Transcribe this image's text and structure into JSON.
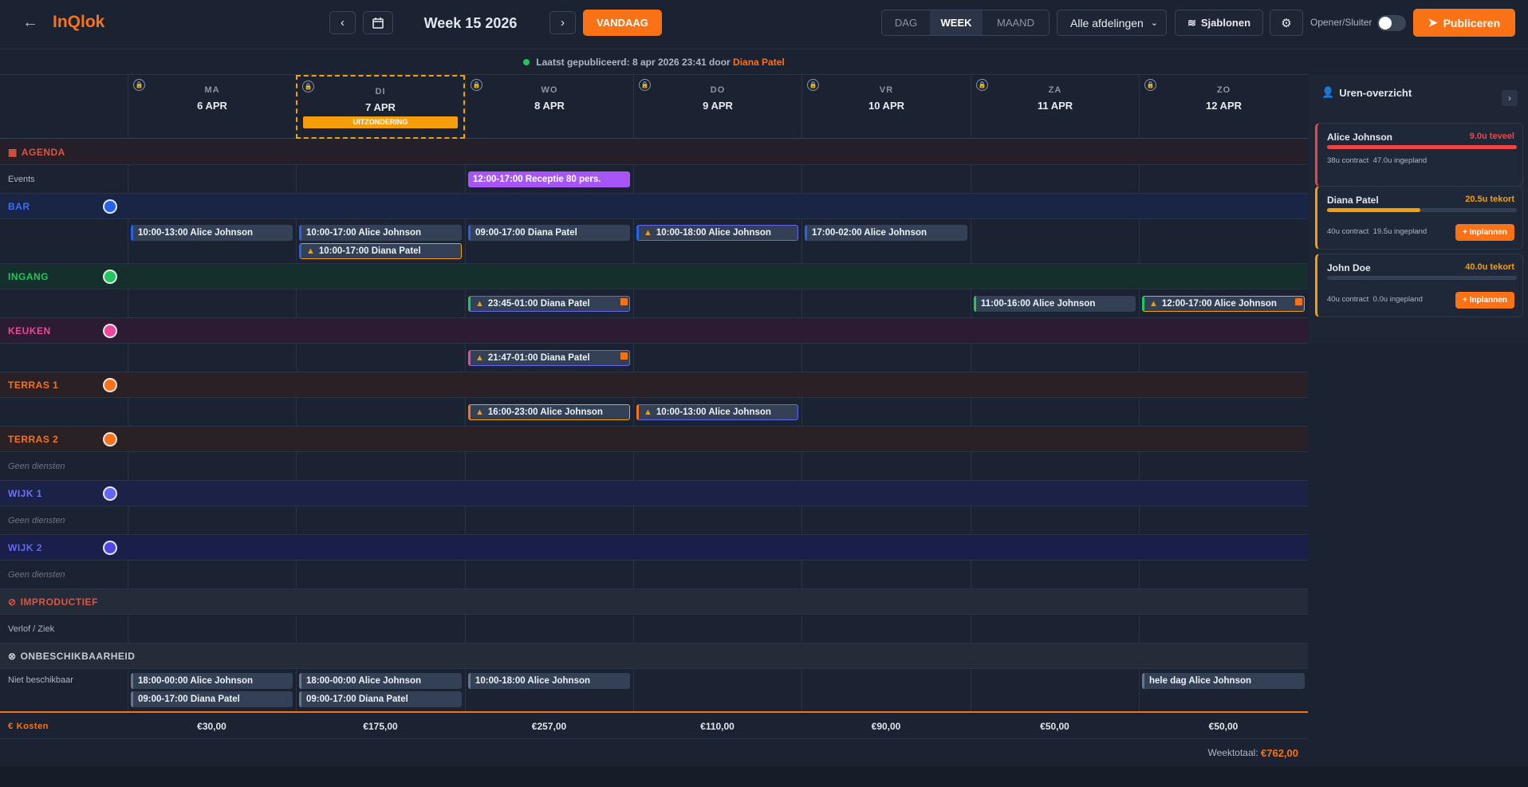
{
  "header": {
    "logo": "InQlok",
    "week_title": "Week 15 2026",
    "today": "VANDAAG",
    "views": [
      "DAG",
      "WEEK",
      "MAAND"
    ],
    "dept_select": "Alle afdelingen",
    "templates": "Sjablonen",
    "opener_label": "Opener/Sluiter",
    "publish": "Publiceren"
  },
  "status": {
    "text": "Laatst gepubliceerd: 8 apr 2026 23:41 door",
    "user": "Diana Patel"
  },
  "days": [
    {
      "name": "MA",
      "date": "6 APR"
    },
    {
      "name": "DI",
      "date": "7 APR",
      "badge": "UITZONDERING"
    },
    {
      "name": "WO",
      "date": "8 APR"
    },
    {
      "name": "DO",
      "date": "9 APR"
    },
    {
      "name": "VR",
      "date": "10 APR"
    },
    {
      "name": "ZA",
      "date": "11 APR"
    },
    {
      "name": "ZO",
      "date": "12 APR"
    }
  ],
  "agenda": {
    "title": "AGENDA",
    "events_label": "Events",
    "event": "12:00-17:00 Receptie 80 pers."
  },
  "departments": [
    {
      "name": "BAR",
      "color": "#2563eb"
    },
    {
      "name": "INGANG",
      "color": "#22c55e"
    },
    {
      "name": "KEUKEN",
      "color": "#ec4899"
    },
    {
      "name": "TERRAS 1",
      "color": "#f97316"
    },
    {
      "name": "TERRAS 2",
      "color": "#f97316"
    },
    {
      "name": "WIJK 1",
      "color": "#6366f1"
    },
    {
      "name": "WIJK 2",
      "color": "#4f46e5"
    }
  ],
  "empty_label": "Geen diensten",
  "shifts": {
    "bar": [
      "10:00-13:00 Alice Johnson",
      "10:00-17:00 Alice Johnson",
      "10:00-17:00 Diana Patel",
      "09:00-17:00 Diana Patel",
      "10:00-18:00 Alice Johnson",
      "17:00-02:00 Alice Johnson"
    ],
    "ingang": [
      "23:45-01:00 Diana Patel",
      "11:00-16:00 Alice Johnson",
      "12:00-17:00 Alice Johnson"
    ],
    "keuken": [
      "21:47-01:00 Diana Patel"
    ],
    "terras1": [
      "16:00-23:00 Alice Johnson",
      "10:00-13:00 Alice Johnson"
    ]
  },
  "improductief": {
    "title": "IMPRODUCTIEF",
    "label": "Verlof / Ziek"
  },
  "onbeschikbaar": {
    "title": "ONBESCHIKBAARHEID",
    "label": "Niet beschikbaar",
    "items": [
      "18:00-00:00 Alice Johnson",
      "09:00-17:00 Diana Patel",
      "18:00-00:00 Alice Johnson",
      "09:00-17:00 Diana Patel",
      "10:00-18:00 Alice Johnson",
      "hele dag Alice Johnson"
    ]
  },
  "costs": {
    "label": "Kosten",
    "values": [
      "€30,00",
      "€175,00",
      "€257,00",
      "€110,00",
      "€90,00",
      "€50,00",
      "€50,00"
    ],
    "total_label": "Weektotaal:",
    "total": "€762,00"
  },
  "sidebar": {
    "title": "Uren-overzicht",
    "plan_label": "+ Inplannen",
    "people": [
      {
        "name": "Alice Johnson",
        "status": "9.0u teveel",
        "contract": "38u contract",
        "planned": "47.0u ingepland",
        "progress": 1.0,
        "color": "#ef4444"
      },
      {
        "name": "Diana Patel",
        "status": "20.5u tekort",
        "contract": "40u contract",
        "planned": "19.5u ingepland",
        "progress": 0.49,
        "color": "#f59e0b"
      },
      {
        "name": "John Doe",
        "status": "40.0u tekort",
        "contract": "40u contract",
        "planned": "0.0u ingepland",
        "progress": 0.0,
        "color": "#f59e0b"
      }
    ]
  }
}
